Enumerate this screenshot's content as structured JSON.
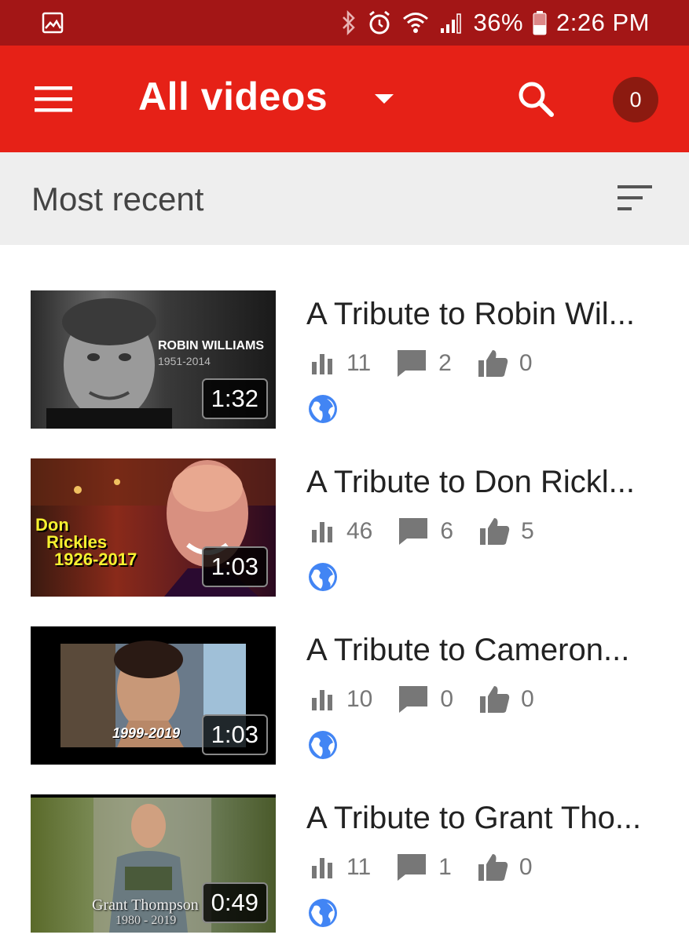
{
  "status_bar": {
    "battery": "36%",
    "time": "2:26 PM"
  },
  "app_bar": {
    "title": "All videos",
    "notification_count": "0"
  },
  "sort": {
    "label": "Most recent"
  },
  "videos": [
    {
      "title": "A Tribute to Robin Wil...",
      "duration": "1:32",
      "views": "11",
      "comments": "2",
      "likes": "0",
      "thumb_text": [
        "ROBIN WILLIAMS",
        "1951-2014"
      ]
    },
    {
      "title": "A Tribute to Don Rickl...",
      "duration": "1:03",
      "views": "46",
      "comments": "6",
      "likes": "5",
      "thumb_text": [
        "Don",
        "Rickles",
        "1926-2017"
      ]
    },
    {
      "title": "A Tribute to Cameron...",
      "duration": "1:03",
      "views": "10",
      "comments": "0",
      "likes": "0",
      "thumb_text": [
        "1999-2019"
      ]
    },
    {
      "title": "A Tribute to Grant Tho...",
      "duration": "0:49",
      "views": "11",
      "comments": "1",
      "likes": "0",
      "thumb_text": [
        "Grant Thompson",
        "1980 - 2019"
      ]
    }
  ],
  "colors": {
    "status_bar": "#a31616",
    "app_bar": "#e62117",
    "badge": "#8c1a10",
    "globe": "#4285f4"
  }
}
